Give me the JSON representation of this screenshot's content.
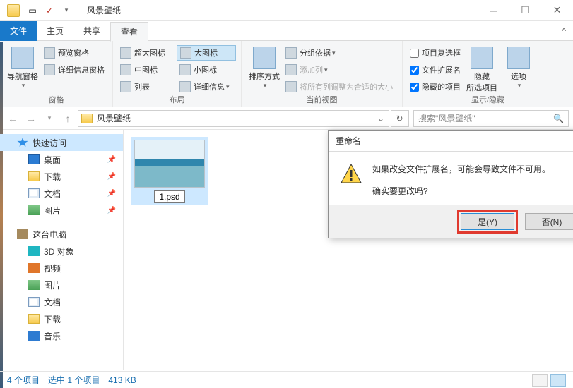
{
  "window": {
    "title": "风景壁纸"
  },
  "tabs": {
    "file": "文件",
    "home": "主页",
    "share": "共享",
    "view": "查看"
  },
  "ribbon": {
    "panes": {
      "label": "窗格",
      "nav": "导航窗格",
      "preview": "预览窗格",
      "details": "详细信息窗格"
    },
    "layout": {
      "label": "布局",
      "xlarge": "超大图标",
      "large": "大图标",
      "medium": "中图标",
      "small": "小图标",
      "list": "列表",
      "details": "详细信息"
    },
    "current_view": {
      "label": "当前视图",
      "sort": "排序方式",
      "group": "分组依据",
      "add_col": "添加列",
      "fit_cols": "将所有列调整为合适的大小"
    },
    "show_hide": {
      "label": "显示/隐藏",
      "item_check": "项目复选框",
      "file_ext": "文件扩展名",
      "hidden_items": "隐藏的项目",
      "hide": "隐藏",
      "hide2": "所选项目",
      "options": "选项"
    }
  },
  "address": {
    "path": "风景壁纸",
    "search_placeholder": "搜索\"风景壁纸\""
  },
  "sidebar": {
    "quick": "快速访问",
    "desktop": "桌面",
    "downloads": "下载",
    "documents": "文档",
    "pictures": "图片",
    "thispc": "这台电脑",
    "objects3d": "3D 对象",
    "videos": "视频",
    "pictures2": "图片",
    "documents2": "文档",
    "downloads2": "下载",
    "music": "音乐"
  },
  "files": {
    "item1": "1.psd"
  },
  "dialog": {
    "title": "重命名",
    "line1": "如果改变文件扩展名，可能会导致文件不可用。",
    "line2": "确实要更改吗?",
    "yes": "是(Y)",
    "no": "否(N)"
  },
  "status": {
    "count": "4 个项目",
    "selected": "选中 1 个项目",
    "size": "413 KB"
  }
}
